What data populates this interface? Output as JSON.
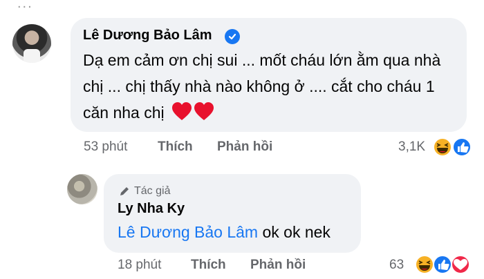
{
  "top_remnant": {
    "text": "..."
  },
  "comment1": {
    "author": "Lê Dương Bảo Lâm",
    "text": "Dạ em cảm ơn chị sui ... mốt cháu lớn ằm qua nhà chị ... chị thấy nhà nào không ở .... cắt cho cháu 1 căn nha chị",
    "emoji": "❤️❤️",
    "time": "53 phút",
    "like_label": "Thích",
    "reply_label": "Phản hồi",
    "reaction_count": "3,1K",
    "reactions": [
      "haha-icon",
      "like-icon"
    ]
  },
  "reply": {
    "badge_label": "Tác giả",
    "author": "Ly Nha Ky",
    "mention": "Lê Dương Bảo Lâm",
    "text": " ok ok nek",
    "time": "18 phút",
    "like_label": "Thích",
    "reply_label": "Phản hồi",
    "reaction_count": "63",
    "reactions": [
      "haha-icon",
      "like-icon",
      "love-icon"
    ]
  },
  "colors": {
    "bubble": "#f0f2f5",
    "meta_text": "#65676b",
    "link_blue": "#1877f2",
    "text": "#050505"
  }
}
